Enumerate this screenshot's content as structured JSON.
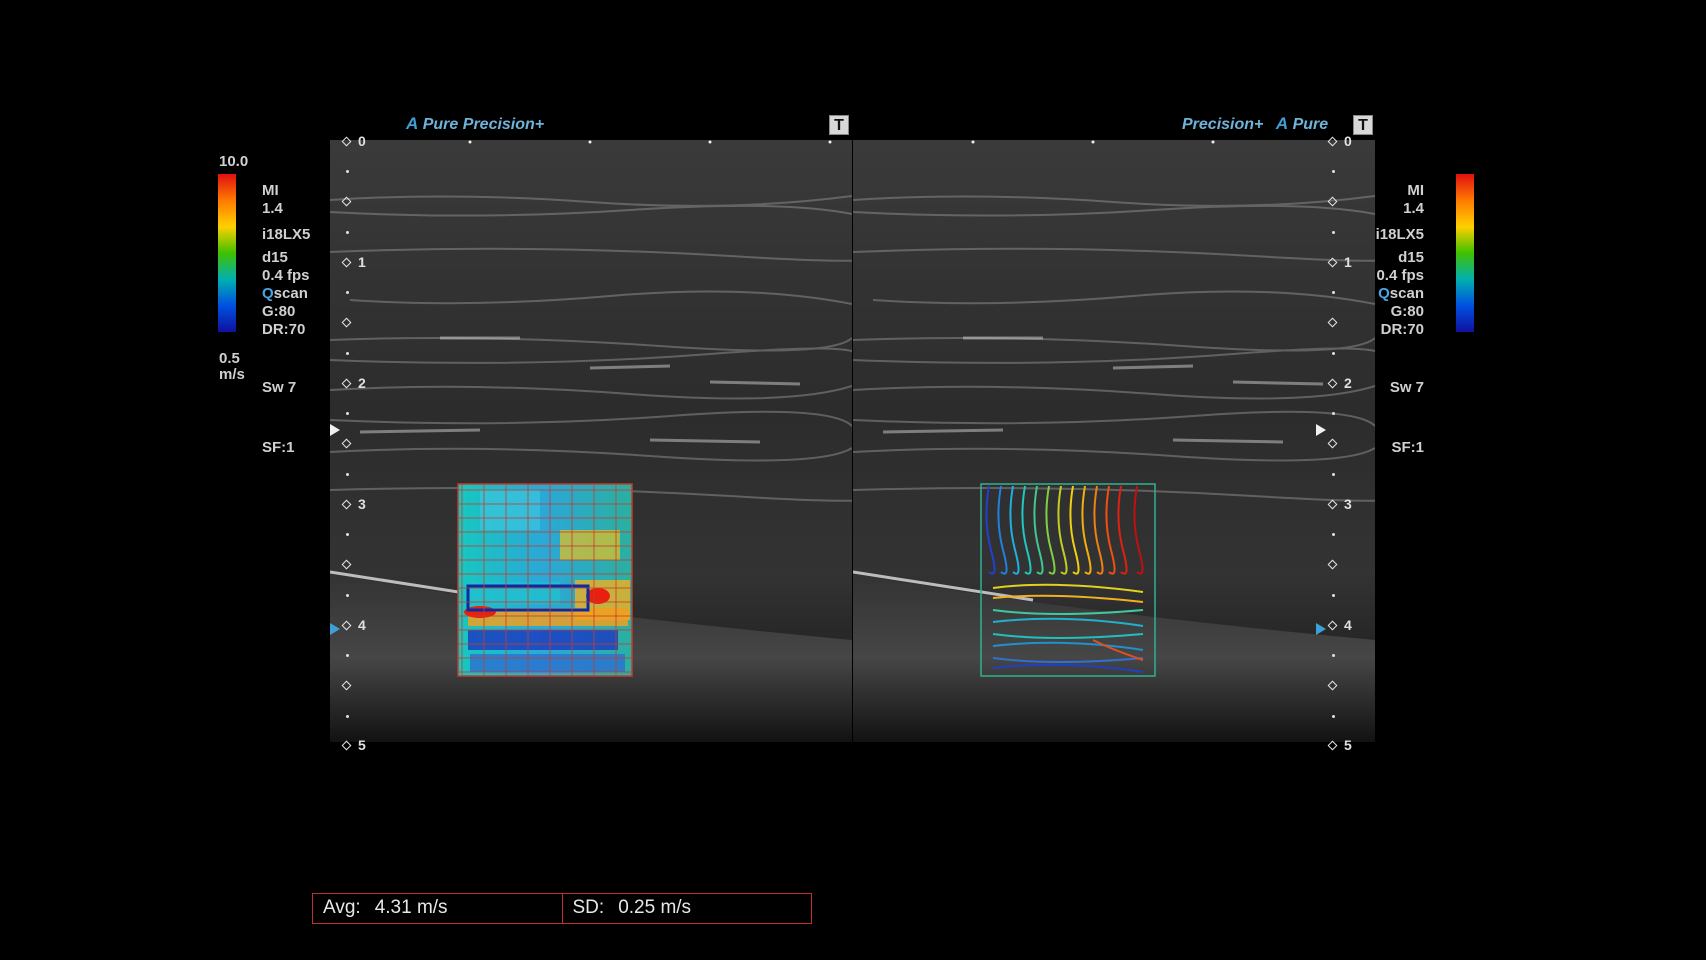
{
  "left_view": {
    "header_a": "A",
    "header_pure": "Pure",
    "header_precision": "Precision+",
    "t_button": "T",
    "depth_labels": [
      "0",
      "1",
      "2",
      "3",
      "4",
      "5"
    ]
  },
  "right_view": {
    "header_precision": "Precision+",
    "header_a": "A",
    "header_pure": "Pure",
    "t_button": "T",
    "depth_labels": [
      "0",
      "1",
      "2",
      "3",
      "4",
      "5"
    ]
  },
  "scale": {
    "max": "10.0",
    "min": "0.5",
    "unit": "m/s"
  },
  "params": {
    "mi_label": "MI",
    "mi_value": "1.4",
    "probe": "i18LX5",
    "depth": "d15",
    "fps": "0.4 fps",
    "qscan_q": "Q",
    "qscan_rest": "scan",
    "gain": "G:80",
    "dr": "DR:70",
    "sw": "Sw 7",
    "sf": "SF:1"
  },
  "stats": {
    "avg_label": "Avg:",
    "avg_value": "4.31 m/s",
    "sd_label": "SD:",
    "sd_value": "0.25 m/s"
  },
  "colors": {
    "accent": "#3da0d8",
    "stats_border": "#c03030"
  }
}
